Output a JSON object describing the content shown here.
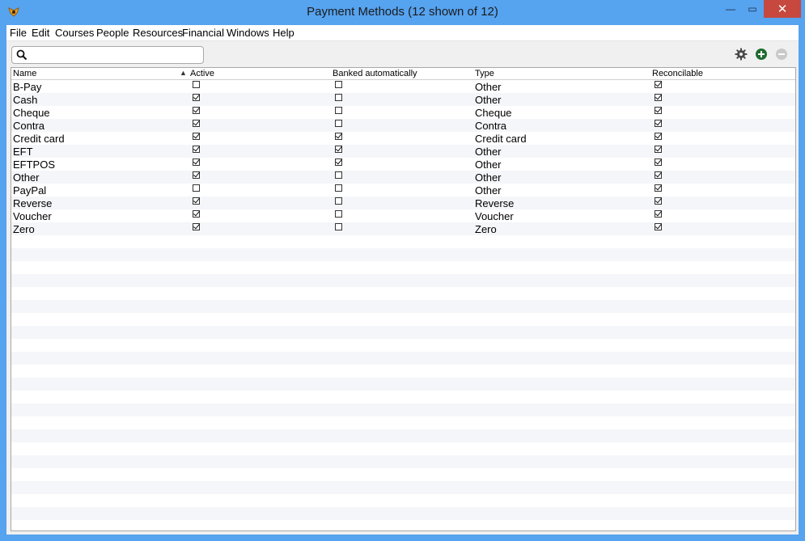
{
  "window": {
    "title": "Payment Methods (12 shown of 12)",
    "minimize_glyph": "—",
    "maximize_glyph": "▭",
    "close_glyph": "✕"
  },
  "menu": [
    "File",
    "Edit",
    "Courses",
    "People",
    "Resources",
    "Financial",
    "Windows",
    "Help"
  ],
  "search": {
    "value": "",
    "placeholder": ""
  },
  "toolbar": {
    "icons": [
      "gear-icon",
      "add-icon",
      "remove-icon"
    ]
  },
  "table": {
    "columns": [
      "Name",
      "Active",
      "Banked automatically",
      "Type",
      "Reconcilable"
    ],
    "rows": [
      {
        "name": "B-Pay",
        "active": false,
        "banked": false,
        "type": "Other",
        "reconcilable": true
      },
      {
        "name": "Cash",
        "active": true,
        "banked": false,
        "type": "Other",
        "reconcilable": true
      },
      {
        "name": "Cheque",
        "active": true,
        "banked": false,
        "type": "Cheque",
        "reconcilable": true
      },
      {
        "name": "Contra",
        "active": true,
        "banked": false,
        "type": "Contra",
        "reconcilable": true
      },
      {
        "name": "Credit card",
        "active": true,
        "banked": true,
        "type": "Credit card",
        "reconcilable": true
      },
      {
        "name": "EFT",
        "active": true,
        "banked": true,
        "type": "Other",
        "reconcilable": true
      },
      {
        "name": "EFTPOS",
        "active": true,
        "banked": true,
        "type": "Other",
        "reconcilable": true
      },
      {
        "name": "Other",
        "active": true,
        "banked": false,
        "type": "Other",
        "reconcilable": true
      },
      {
        "name": "PayPal",
        "active": false,
        "banked": false,
        "type": "Other",
        "reconcilable": true
      },
      {
        "name": "Reverse",
        "active": true,
        "banked": false,
        "type": "Reverse",
        "reconcilable": true
      },
      {
        "name": "Voucher",
        "active": true,
        "banked": false,
        "type": "Voucher",
        "reconcilable": true
      },
      {
        "name": "Zero",
        "active": true,
        "banked": false,
        "type": "Zero",
        "reconcilable": true
      }
    ]
  },
  "colors": {
    "frame": "#56a3f0",
    "close": "#c7483e",
    "add_icon": "#1f6b2e",
    "remove_icon": "#c9c9c9",
    "row_stripe": "#f4f6f9"
  }
}
